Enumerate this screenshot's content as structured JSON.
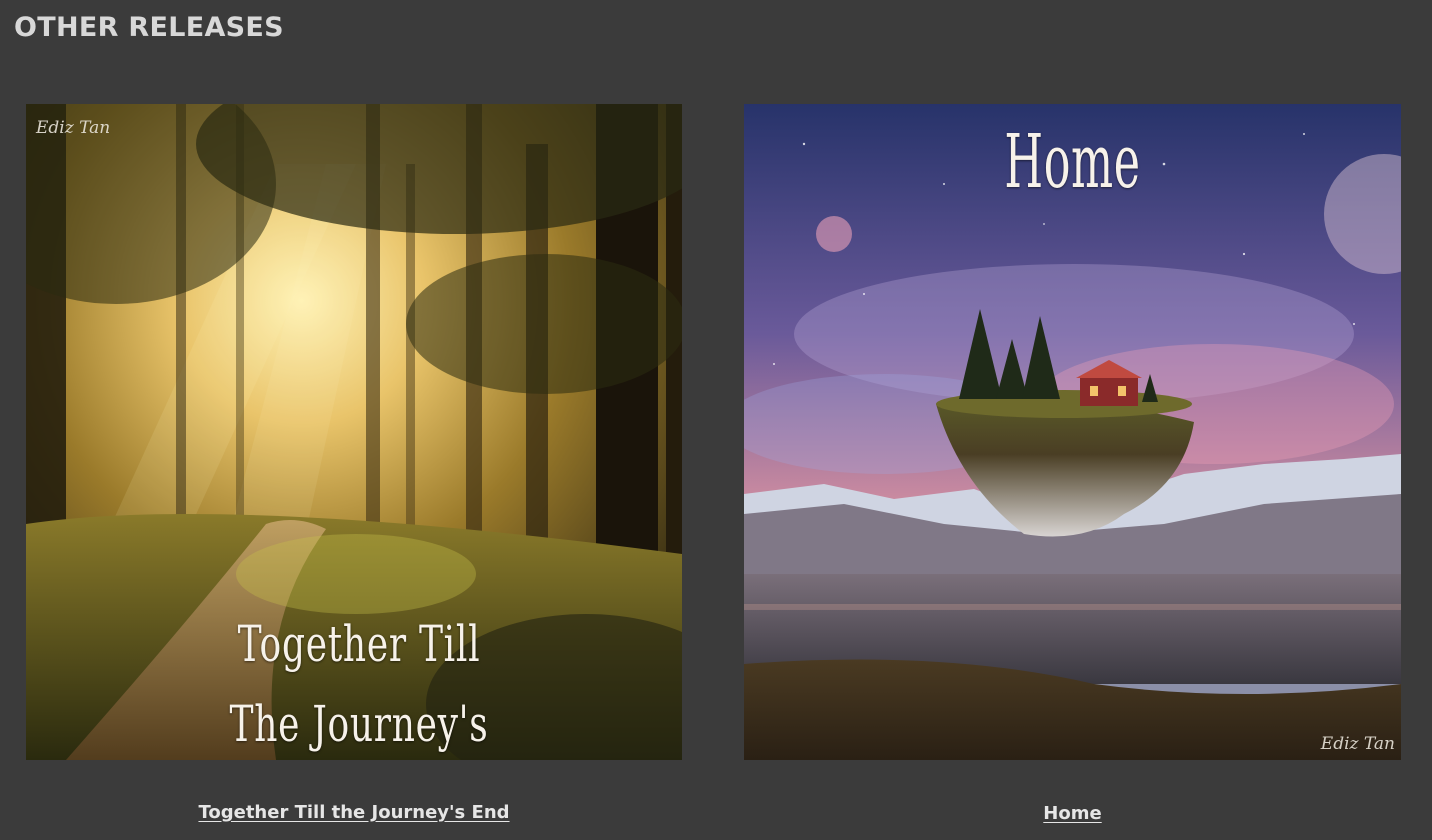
{
  "section": {
    "title": "OTHER RELEASES"
  },
  "releases": [
    {
      "cover_title": "Together Till The Journey's End",
      "cover_artist_signature": "Ediz Tan",
      "caption": "Together Till the Journey's End"
    },
    {
      "cover_title": "Home",
      "cover_artist_signature": "Ediz Tan",
      "caption": "Home"
    }
  ],
  "colors": {
    "background": "#3b3b3b",
    "text": "#e6e6e6"
  }
}
